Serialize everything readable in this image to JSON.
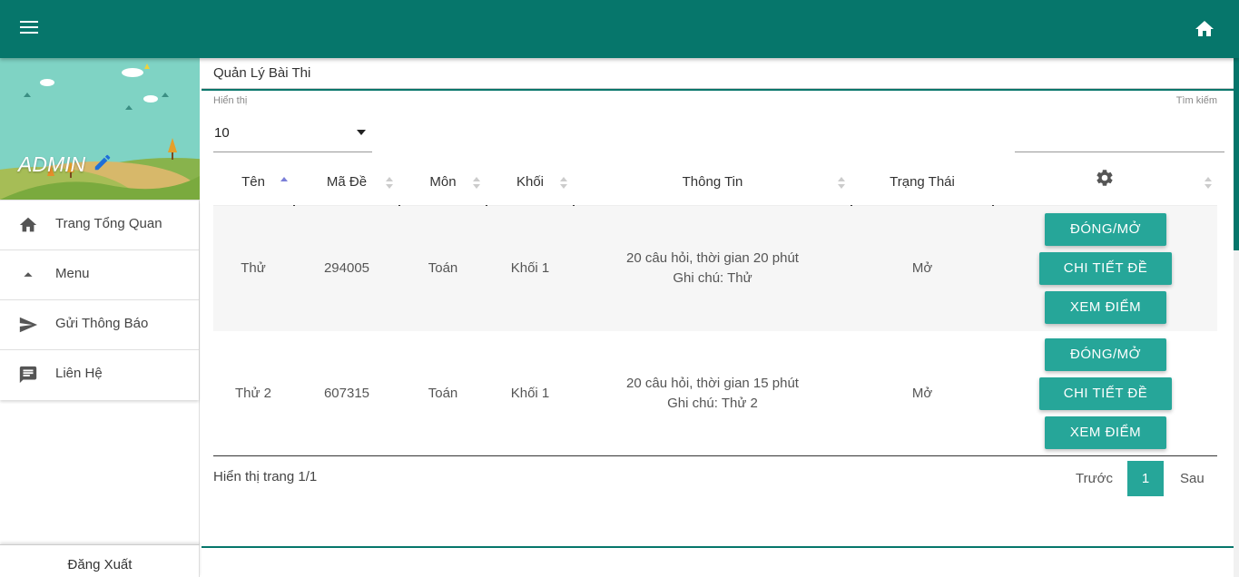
{
  "colors": {
    "primary": "#06766b",
    "button": "#26a699"
  },
  "header": {
    "menu_icon": "hamburger-icon",
    "home_icon": "home-icon"
  },
  "sidebar": {
    "admin_name": "ADMIN",
    "items": [
      {
        "label": "Trang Tổng Quan",
        "icon": "home-icon"
      },
      {
        "label": "Menu",
        "icon": "caret-up-icon"
      },
      {
        "label": "Gửi Thông Báo",
        "icon": "send-icon"
      },
      {
        "label": "Liên Hệ",
        "icon": "chat-icon"
      }
    ],
    "logout": "Đăng Xuất"
  },
  "page": {
    "title": "Quản Lý Bài Thi",
    "show_label": "Hiển thị",
    "show_value": "10",
    "search_label": "Tìm kiếm",
    "search_value": ""
  },
  "table": {
    "columns": [
      "Tên",
      "Mã Đề",
      "Môn",
      "Khối",
      "Thông Tin",
      "Trạng Thái"
    ],
    "rows": [
      {
        "ten": "Thử",
        "ma_de": "294005",
        "mon": "Toán",
        "khoi": "Khối 1",
        "info_line1": "20 câu hỏi, thời gian 20 phút",
        "info_line2": "Ghi chú: Thử",
        "trang_thai": "Mở",
        "btn_toggle": "ĐÓNG/MỞ",
        "btn_detail": "CHI TIẾT ĐỀ",
        "btn_scores": "XEM ĐIỂM"
      },
      {
        "ten": "Thử 2",
        "ma_de": "607315",
        "mon": "Toán",
        "khoi": "Khối 1",
        "info_line1": "20 câu hỏi, thời gian 15 phút",
        "info_line2": "Ghi chú: Thử 2",
        "trang_thai": "Mở",
        "btn_toggle": "ĐÓNG/MỞ",
        "btn_detail": "CHI TIẾT ĐỀ",
        "btn_scores": "XEM ĐIỂM"
      }
    ]
  },
  "pagination": {
    "info": "Hiển thị trang 1/1",
    "prev": "Trước",
    "current": "1",
    "next": "Sau"
  }
}
